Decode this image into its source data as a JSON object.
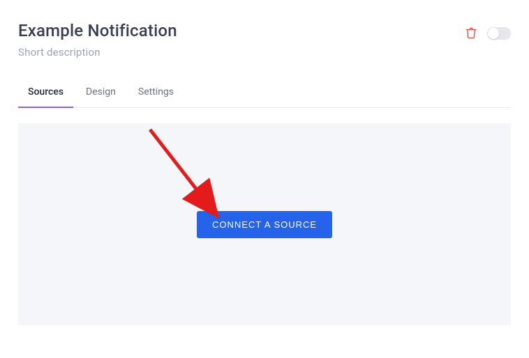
{
  "header": {
    "title": "Example Notification",
    "subtitle": "Short description"
  },
  "tabs": [
    {
      "label": "Sources",
      "active": true
    },
    {
      "label": "Design",
      "active": false
    },
    {
      "label": "Settings",
      "active": false
    }
  ],
  "content": {
    "connect_button": "Connect a Source"
  },
  "toggle": {
    "enabled": false
  }
}
